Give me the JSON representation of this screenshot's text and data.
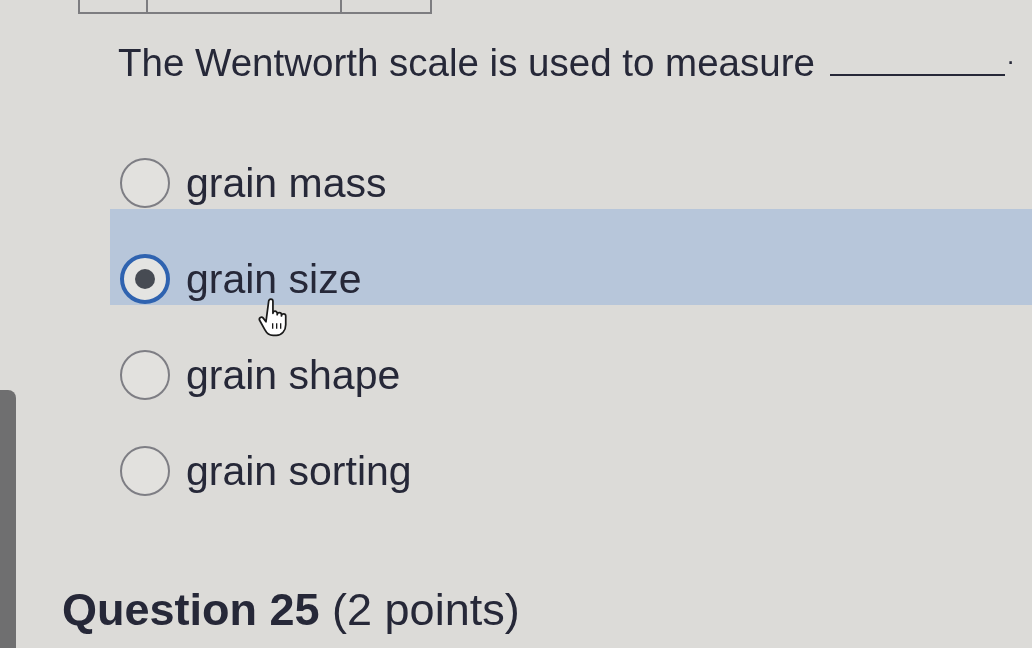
{
  "question": {
    "text": "The Wentworth scale is used to measure",
    "has_blank": true,
    "end": "."
  },
  "options": [
    {
      "label": "grain mass",
      "selected": false
    },
    {
      "label": "grain size",
      "selected": true
    },
    {
      "label": "grain shape",
      "selected": false
    },
    {
      "label": "grain sorting",
      "selected": false
    }
  ],
  "next_question": {
    "heading": "**Question 25** (2 points)"
  }
}
